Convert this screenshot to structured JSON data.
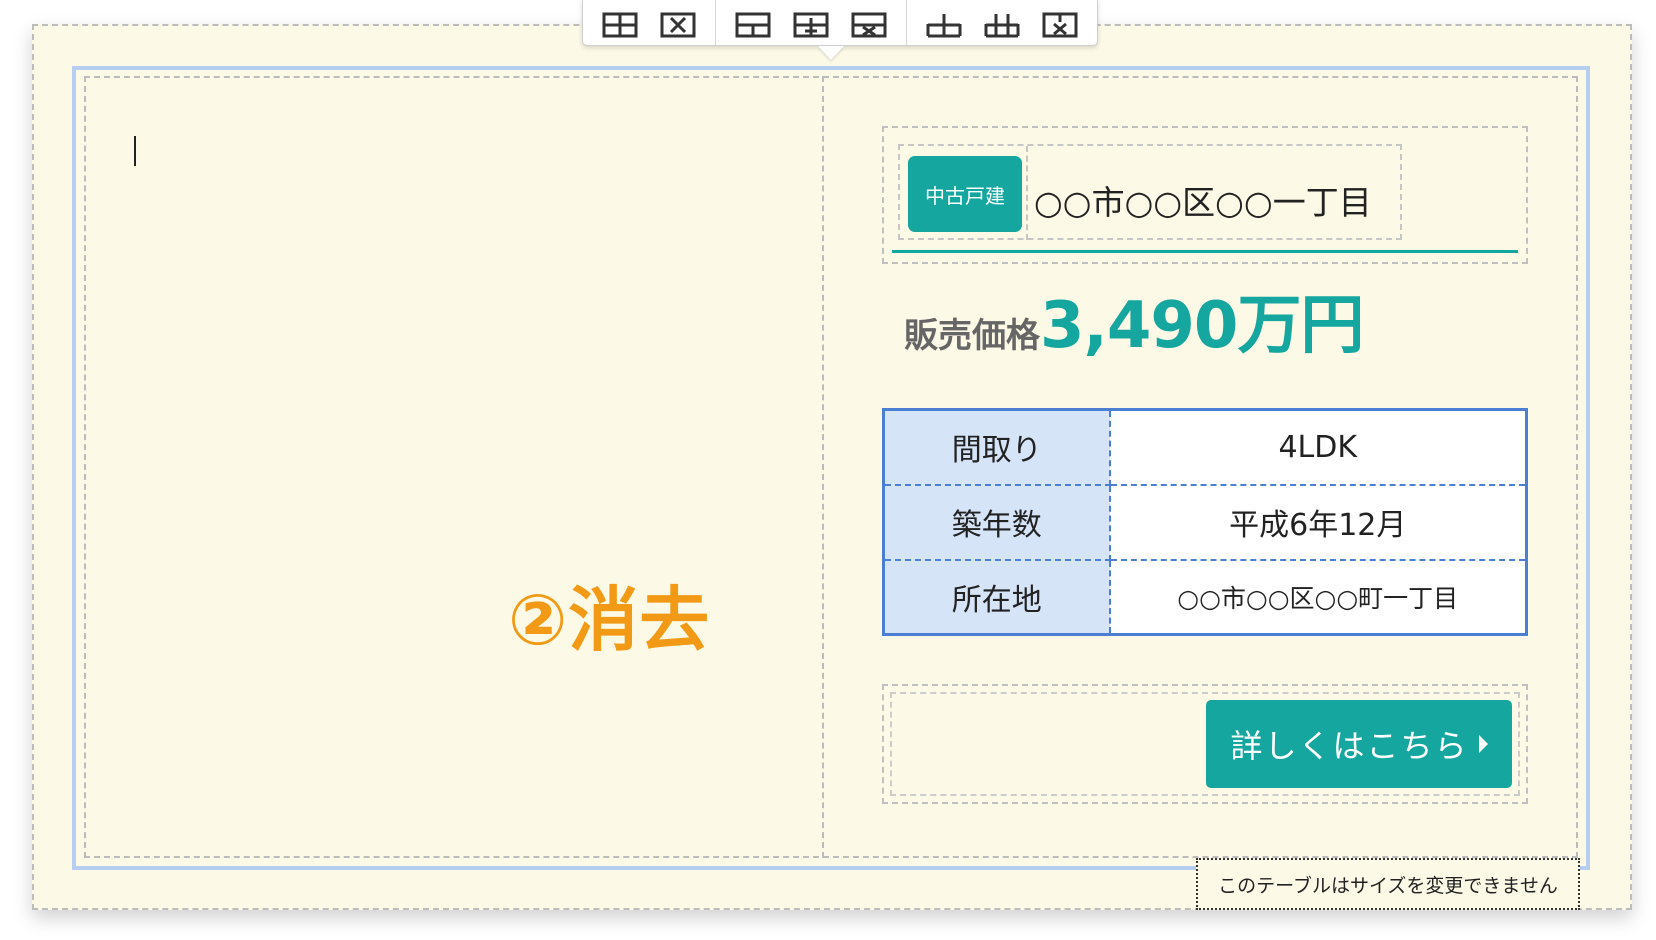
{
  "toolbar": {
    "groups": [
      [
        "table-icon",
        "delete-table-icon"
      ],
      [
        "insert-row-icon",
        "insert-column-icon",
        "delete-row-icon"
      ],
      [
        "merge-cells-icon",
        "split-cells-icon",
        "delete-cell-icon"
      ]
    ]
  },
  "annotation": {
    "erase_label": "②消去"
  },
  "property": {
    "badge": "中古戸建",
    "address_title": "○○市○○区○○一丁目",
    "price_label": "販売価格",
    "price_value": "3,490万円",
    "specs": [
      {
        "key": "間取り",
        "value": "4LDK"
      },
      {
        "key": "築年数",
        "value": "平成6年12月"
      },
      {
        "key": "所在地",
        "value": "○○市○○区○○町一丁目"
      }
    ],
    "detail_button": "詳しくはこちら"
  },
  "tooltip": {
    "resize_notice": "このテーブルはサイズを変更できません"
  },
  "colors": {
    "accent": "#15a69f",
    "annotation": "#f29a15",
    "table_border": "#4a7fd3",
    "table_header_bg": "#d6e4f8",
    "background": "#fcf9e6"
  }
}
